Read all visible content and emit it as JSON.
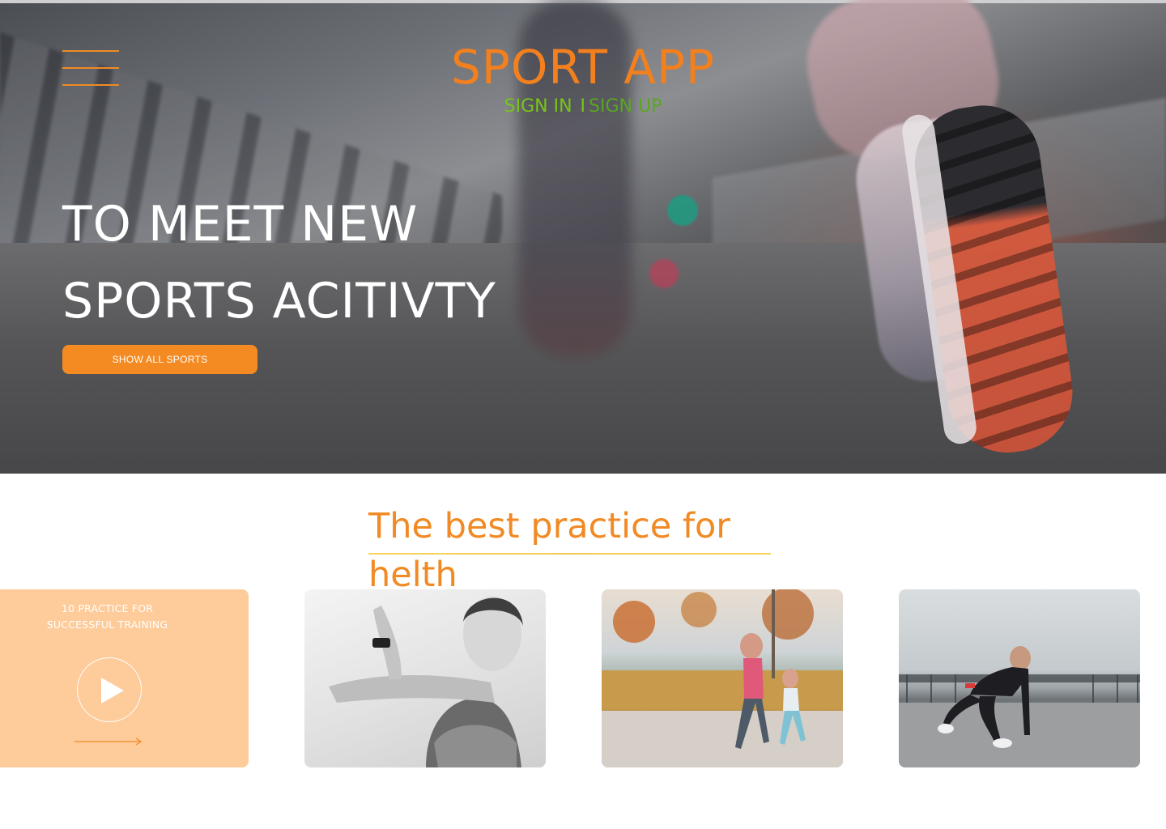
{
  "header": {
    "brand": "SPORT APP",
    "sign_in": "SIGN IN",
    "separator": "I",
    "sign_up": "SIGN UP",
    "menu_icon": "hamburger-menu-icon"
  },
  "hero": {
    "headline_line1": "TO MEET NEW",
    "headline_line2": "SPORTS ACITIVTY",
    "cta_label": "SHOW ALL SPORTS",
    "background_image": "runner-shoes-photo"
  },
  "section": {
    "title": "The best practice for helth"
  },
  "cards": {
    "promo": {
      "line1": "10 PRACTICE FOR",
      "line2": "SUCCESSFUL TRAINING",
      "play_icon": "play-icon",
      "arrow_icon": "arrow-right-icon"
    },
    "images": [
      "woman-stretching-photo",
      "mother-daughter-running-photo",
      "man-sprint-start-photo"
    ]
  },
  "colors": {
    "accent": "#f18a24",
    "cta": "#f48a22",
    "auth_green": "#79c41a",
    "promo_bg": "#fecb9a",
    "title_underline": "#f4d04c"
  }
}
